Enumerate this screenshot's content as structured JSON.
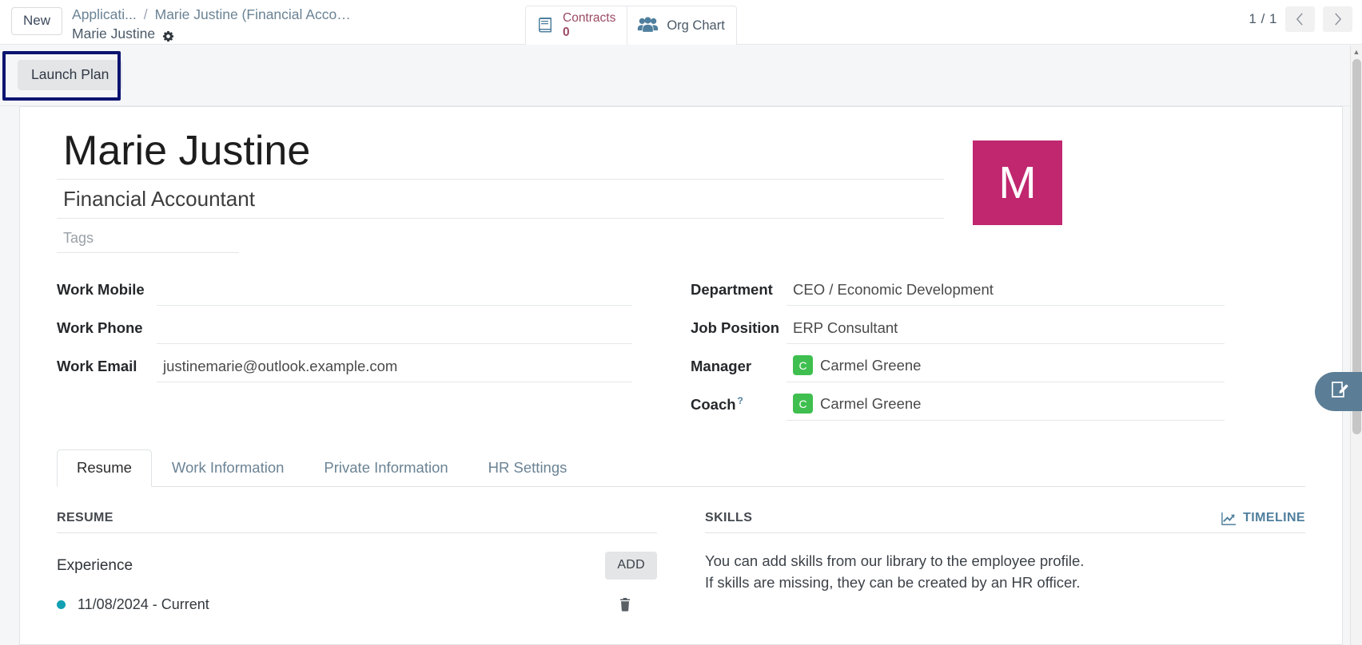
{
  "control_panel": {
    "new_button": "New",
    "breadcrumb": {
      "parent": "Applicati...",
      "separator": "/",
      "record_truncated": "Marie Justine (Financial Accou...",
      "record_name": "Marie Justine",
      "settings_icon": "gear-icon"
    },
    "stat_buttons": [
      {
        "icon": "book-icon",
        "label": "Contracts",
        "value": "0"
      },
      {
        "icon": "people-icon",
        "label": "Org Chart",
        "value": ""
      }
    ],
    "pager": {
      "count": "1 / 1",
      "previous_icon": "chevron-left-icon",
      "next_icon": "chevron-right-icon"
    }
  },
  "action_bar": {
    "launch_plan_button": "Launch Plan",
    "highlight_color": "#0b1470"
  },
  "record": {
    "name": "Marie Justine",
    "job_title": "Financial Accountant",
    "tags_placeholder": "Tags",
    "avatar_letter": "M",
    "avatar_color": "#c0276f",
    "left_fields": [
      {
        "label": "Work Mobile",
        "value": ""
      },
      {
        "label": "Work Phone",
        "value": ""
      },
      {
        "label": "Work Email",
        "value": "justinemarie@outlook.example.com"
      }
    ],
    "right_fields": [
      {
        "label": "Department",
        "value": "CEO / Economic Development",
        "avatar": "",
        "help": false
      },
      {
        "label": "Job Position",
        "value": "ERP Consultant",
        "avatar": "",
        "help": false
      },
      {
        "label": "Manager",
        "value": "Carmel Greene",
        "avatar": "C",
        "help": false
      },
      {
        "label": "Coach",
        "value": "Carmel Greene",
        "avatar": "C",
        "help": true,
        "help_marker": "?"
      }
    ],
    "avatar_badge_color": "#3fbf4f"
  },
  "tabs": [
    {
      "label": "Resume",
      "active": true
    },
    {
      "label": "Work Information",
      "active": false
    },
    {
      "label": "Private Information",
      "active": false
    },
    {
      "label": "HR Settings",
      "active": false
    }
  ],
  "resume_panel": {
    "heading": "RESUME",
    "section_title": "Experience",
    "add_button": "ADD",
    "entries": [
      {
        "date_range": "11/08/2024 - Current",
        "bullet_color": "#13a0b2",
        "delete_icon": "trash-icon"
      }
    ]
  },
  "skills_panel": {
    "heading": "SKILLS",
    "timeline_link": "TIMELINE",
    "timeline_icon": "line-chart-icon",
    "empty_line_1": "You can add skills from our library to the employee profile.",
    "empty_line_2": "If skills are missing, they can be created by an HR officer."
  },
  "floating_action": {
    "icon": "edit-note-icon",
    "color": "#5b7e96"
  }
}
